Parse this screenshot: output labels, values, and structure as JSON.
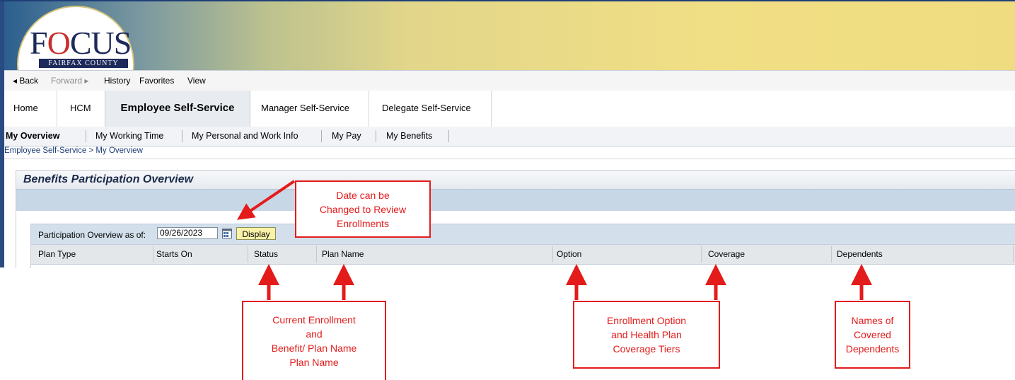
{
  "logo": {
    "main": "FOCUS",
    "sub": "FAIRFAX COUNTY"
  },
  "history_bar": {
    "back": "◂ Back",
    "forward": "Forward ▸",
    "history": "History",
    "favorites": "Favorites",
    "view": "View"
  },
  "top_tabs": [
    "Home",
    "HCM",
    "Employee Self-Service",
    "Manager Self-Service",
    "Delegate Self-Service"
  ],
  "sub_tabs": [
    "My Overview",
    "My Working Time",
    "My Personal and Work Info",
    "My Pay",
    "My Benefits"
  ],
  "breadcrumb": "Employee Self-Service  >  My Overview",
  "panel": {
    "title": "Benefits Participation Overview",
    "filter_label": "Participation Overview as of:",
    "date_value": "09/26/2023",
    "display_button": "Display",
    "columns": [
      "Plan Type",
      "Starts On",
      "Status",
      "Plan Name",
      "Option",
      "Coverage",
      "Dependents"
    ]
  },
  "callouts": {
    "date": [
      "Date can be",
      "Changed to Review",
      "Enrollments"
    ],
    "enrollment": [
      "Current Enrollment",
      "and",
      "Benefit/ Plan Name",
      "Plan Name"
    ],
    "option": [
      "Enrollment Option",
      "and Health Plan",
      "Coverage Tiers"
    ],
    "dependents": [
      "Names of",
      "Covered",
      "Dependents"
    ]
  },
  "colors": {
    "accent": "#e31b1b",
    "header_blue": "#1f3f78",
    "display_button": "#fbf2a8"
  }
}
